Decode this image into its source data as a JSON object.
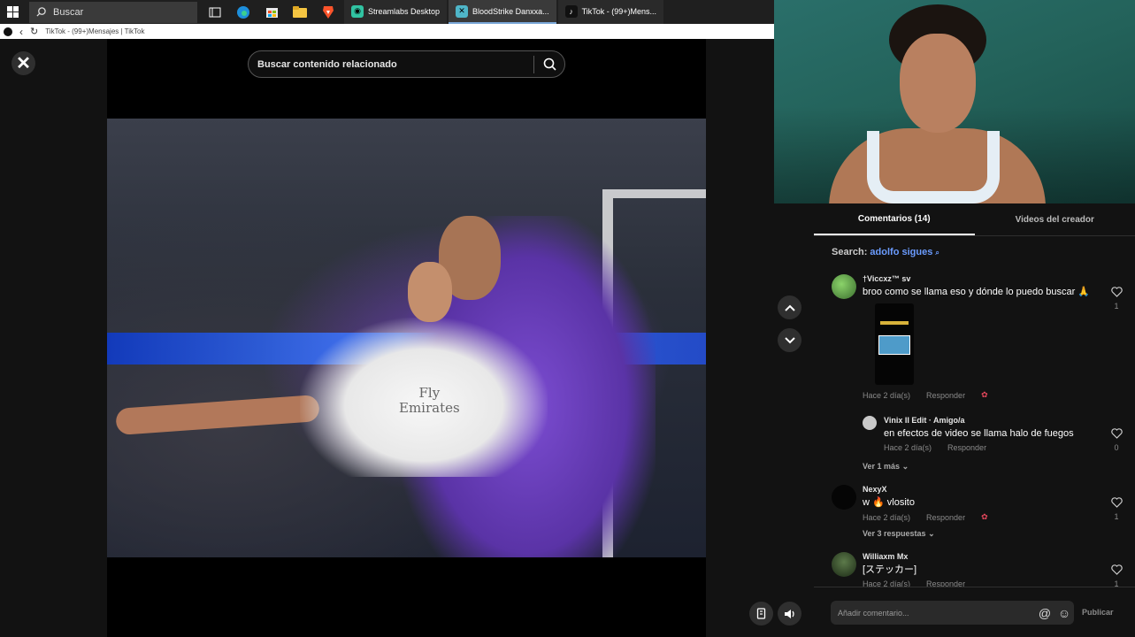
{
  "taskbar": {
    "search_label": "Buscar",
    "apps": [
      {
        "label": "Streamlabs Desktop",
        "icon": "streamlabs-icon",
        "color": "#31c3a2"
      },
      {
        "label": "BloodStrike Danxxa...",
        "icon": "bloodstrike-icon",
        "color": "#4fb6c9"
      },
      {
        "label": "TikTok - (99+)Mens...",
        "icon": "tiktok-icon",
        "color": "#ffffff"
      }
    ]
  },
  "browser": {
    "page_title": "TikTok - (99+)Mensajes | TikTok"
  },
  "viewer": {
    "related_search_placeholder": "Buscar contenido relacionado",
    "video_sponsor": "Fly\nEmirates"
  },
  "panel": {
    "tabs": [
      {
        "label": "Comentarios (14)",
        "active": true
      },
      {
        "label": "Videos del creador",
        "active": false
      }
    ],
    "search_prefix": "Search:",
    "search_keyword": "adolfo sigues"
  },
  "comments": [
    {
      "user": "†Viccxz™ sv",
      "text": "broo como se llama eso y dónde lo puedo buscar 🙏",
      "time": "Hace 2 día(s)",
      "reply_label": "Responder",
      "likes": "1"
    },
    {
      "user": "Vinix II Edit · Amigo/a",
      "text": "en efectos de video se llama halo de fuegos",
      "time": "Hace 2 día(s)",
      "reply_label": "Responder",
      "likes": "0"
    },
    {
      "user": "NexyX",
      "text": "w 🔥 vlosito",
      "time": "Hace 2 día(s)",
      "reply_label": "Responder",
      "likes": "1"
    },
    {
      "user": "Williaxm Mx",
      "text": "[ステッカー]",
      "time": "Hace 2 día(s)",
      "reply_label": "Responder",
      "likes": "1"
    }
  ],
  "more_links": {
    "first": "Ver 1 más",
    "second": "Ver 3 respuestas"
  },
  "comment_bar": {
    "placeholder": "Añadir comentario...",
    "publish_label": "Publicar"
  }
}
